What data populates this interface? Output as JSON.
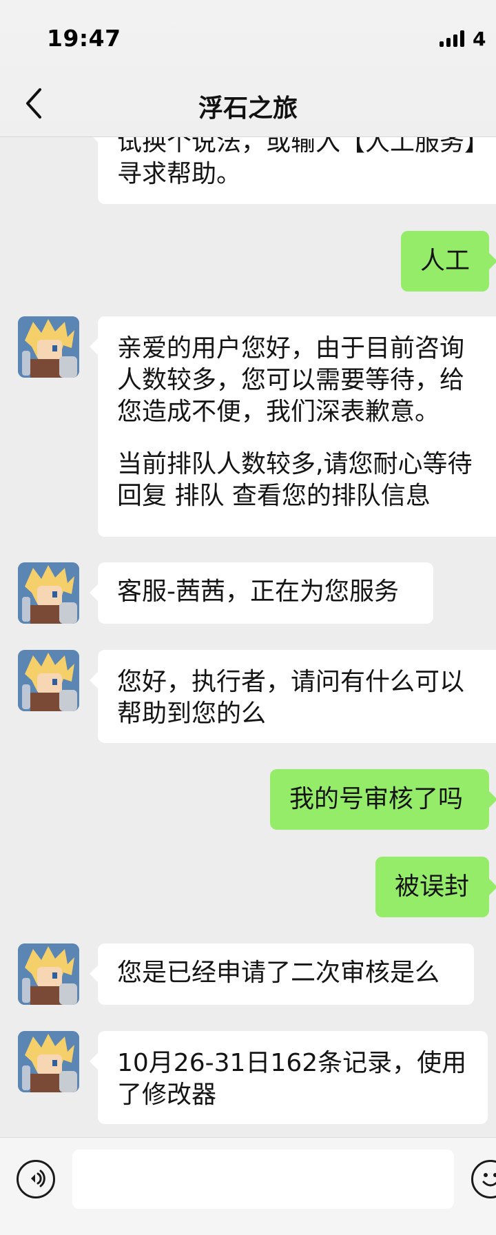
{
  "status_bar": {
    "time": "19:47",
    "network": "4"
  },
  "nav": {
    "back_icon": "chevron-left",
    "title": "浮石之旅"
  },
  "messages": [
    {
      "side": "left",
      "paragraphs": [
        "试换个说法，或输入【人工服务】寻求帮助。"
      ]
    },
    {
      "side": "right",
      "paragraphs": [
        "人工"
      ]
    },
    {
      "side": "left",
      "paragraphs": [
        "亲爱的用户您好，由于目前咨询人数较多，您可以需要等待，给您造成不便，我们深表歉意。",
        "当前排队人数较多,请您耐心等待回复 排队 查看您的排队信息"
      ]
    },
    {
      "side": "left",
      "paragraphs": [
        "客服-茜茜，正在为您服务"
      ]
    },
    {
      "side": "left",
      "paragraphs": [
        "您好，执行者，请问有什么可以帮助到您的么"
      ]
    },
    {
      "side": "right",
      "paragraphs": [
        "我的号审核了吗"
      ]
    },
    {
      "side": "right",
      "paragraphs": [
        "被误封"
      ]
    },
    {
      "side": "left",
      "paragraphs": [
        "您是已经申请了二次审核是么"
      ]
    },
    {
      "side": "left",
      "paragraphs": [
        "10月26-31日162条记录，使用了修改器"
      ]
    }
  ],
  "input_bar": {
    "voice_icon": "voice-icon",
    "text_value": "",
    "emoji_icon": "emoji-icon"
  },
  "colors": {
    "background": "#ededed",
    "incoming_bubble": "#ffffff",
    "outgoing_bubble": "#95ec69"
  }
}
